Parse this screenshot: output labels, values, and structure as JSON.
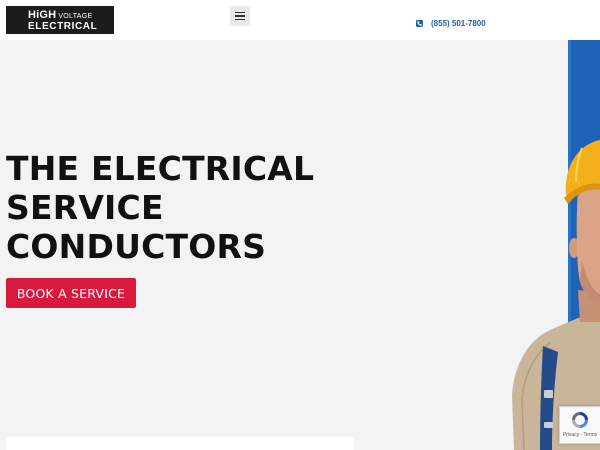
{
  "header": {
    "logo": {
      "high": "HiGH",
      "voltage": "VOLTAGE",
      "electrical": "ELECTRICAL"
    },
    "menu_icon": "hamburger-menu-icon",
    "phone": {
      "icon": "phone-icon",
      "number": "(855) 501-7800"
    }
  },
  "hero": {
    "title_lines": [
      "THE ELECTRICAL",
      "SERVICE",
      "CONDUCTORS"
    ],
    "cta_label": "BOOK A SERVICE",
    "image": "electrician-worker-photo"
  },
  "recaptcha": {
    "icon": "recaptcha-icon",
    "links": "Privacy - Terms"
  },
  "colors": {
    "page_background": "#f3f3f3",
    "header_background": "#ffffff",
    "logo_background": "#1c1c1c",
    "accent_red": "#d91a3f",
    "link_blue": "#1f5fa8",
    "heading_text": "#111111",
    "image_background_blue": "#1e63b8"
  }
}
